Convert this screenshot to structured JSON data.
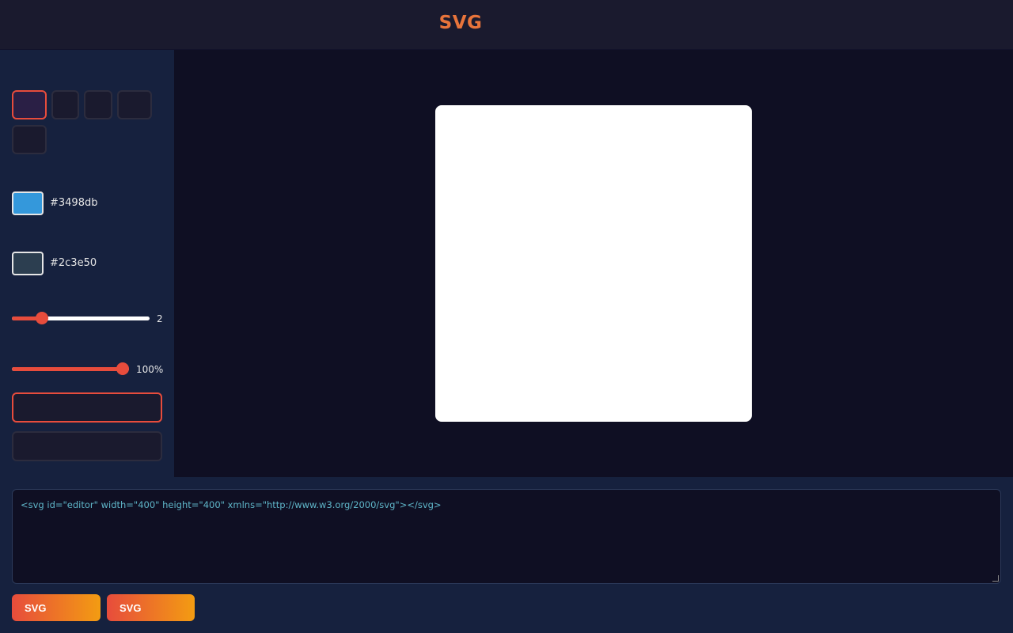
{
  "header": {
    "title": "SVG"
  },
  "toolbar": {
    "tools": [
      {
        "name": "tool-1",
        "active": true
      },
      {
        "name": "tool-2",
        "active": false
      },
      {
        "name": "tool-3",
        "active": false
      },
      {
        "name": "tool-4",
        "active": false
      },
      {
        "name": "tool-5",
        "active": false
      }
    ]
  },
  "fill": {
    "color": "#3498db",
    "label": "#3498db"
  },
  "stroke": {
    "color": "#2c3e50",
    "label": "#2c3e50"
  },
  "stroke_width": {
    "value": 2,
    "max": 20,
    "label": "2"
  },
  "opacity": {
    "value": 100,
    "max": 100,
    "label": "100%"
  },
  "code": {
    "content": "<svg id=\"editor\" width=\"400\" height=\"400\" xmlns=\"http://www.w3.org/2000/svg\"></svg>"
  },
  "actions": {
    "button_1": "SVG",
    "button_2": "SVG"
  },
  "colors": {
    "accent": "#e74c3c",
    "gradient_end": "#f39c12",
    "title": "#e8743b"
  }
}
